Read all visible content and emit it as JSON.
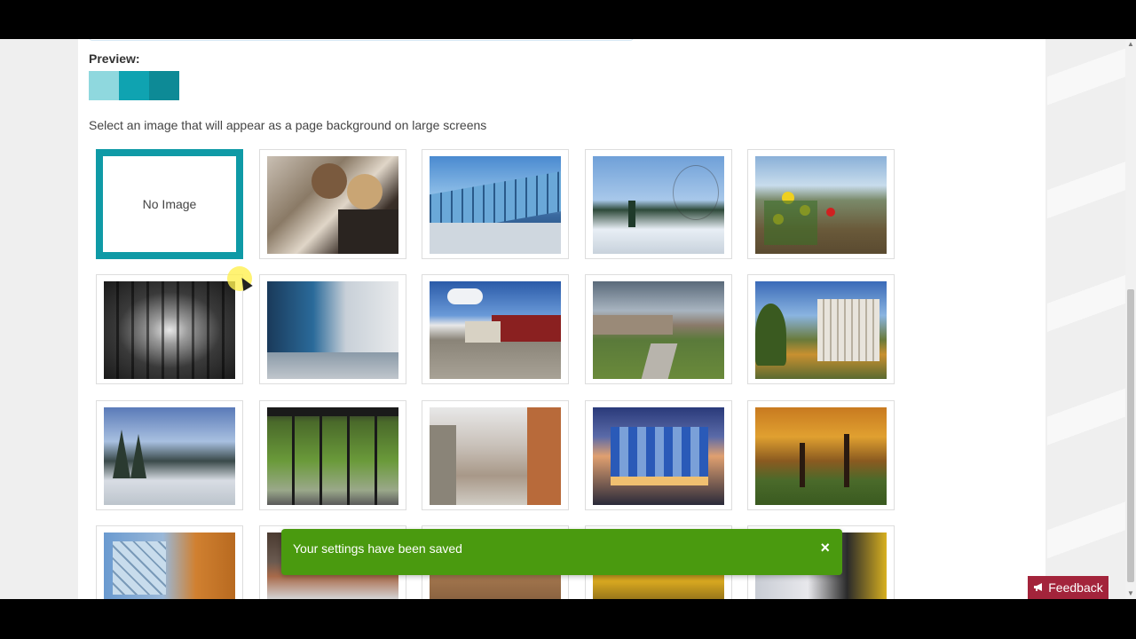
{
  "preview": {
    "label": "Preview:",
    "swatch_colors": [
      "#8fd8de",
      "#0fa3b1",
      "#0d8a96"
    ]
  },
  "instruction": "Select an image that will appear as a page background on large screens",
  "no_image_label": "No Image",
  "selected_index": 0,
  "accent_color": "#0f9aa6",
  "images": [
    {
      "name": "no-image",
      "icon": "none"
    },
    {
      "name": "students-studying",
      "icon": "photo"
    },
    {
      "name": "glass-bridge-building",
      "icon": "photo"
    },
    {
      "name": "winter-campus-path",
      "icon": "photo"
    },
    {
      "name": "tulips-greenhouse",
      "icon": "photo"
    },
    {
      "name": "covered-walkway",
      "icon": "photo"
    },
    {
      "name": "blue-corridor",
      "icon": "photo"
    },
    {
      "name": "campus-plaza",
      "icon": "photo"
    },
    {
      "name": "garden-pathway",
      "icon": "photo"
    },
    {
      "name": "autumn-building",
      "icon": "photo"
    },
    {
      "name": "snowy-trees",
      "icon": "photo"
    },
    {
      "name": "courtyard-window",
      "icon": "photo"
    },
    {
      "name": "atrium-interior",
      "icon": "photo"
    },
    {
      "name": "blue-glass-building",
      "icon": "photo"
    },
    {
      "name": "autumn-trees",
      "icon": "photo"
    },
    {
      "name": "glass-cube-autumn",
      "icon": "photo"
    },
    {
      "name": "winter-creek",
      "icon": "photo"
    },
    {
      "name": "brick-building",
      "icon": "photo"
    },
    {
      "name": "crowd-yellow",
      "icon": "photo"
    },
    {
      "name": "hockey-players",
      "icon": "photo"
    }
  ],
  "toast": {
    "message": "Your settings have been saved",
    "close_icon": "×"
  },
  "feedback": {
    "icon": "megaphone-icon",
    "label": "Feedback"
  }
}
